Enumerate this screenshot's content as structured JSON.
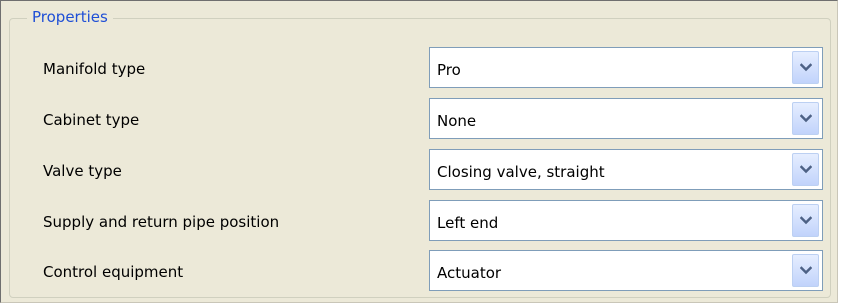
{
  "group": {
    "title": "Properties"
  },
  "rows": [
    {
      "label": "Manifold type",
      "value": "Pro"
    },
    {
      "label": "Cabinet type",
      "value": "None"
    },
    {
      "label": "Valve type",
      "value": "Closing valve, straight"
    },
    {
      "label": "Supply and return pipe position",
      "value": "Left end"
    },
    {
      "label": "Control equipment",
      "value": "Actuator"
    }
  ],
  "icons": {
    "dropdown": "chevron-down-icon"
  },
  "colors": {
    "panel_background": "#ece9d8",
    "group_title": "#1f4fd6",
    "combo_border": "#7f9db9",
    "chevron": "#4d6185"
  }
}
